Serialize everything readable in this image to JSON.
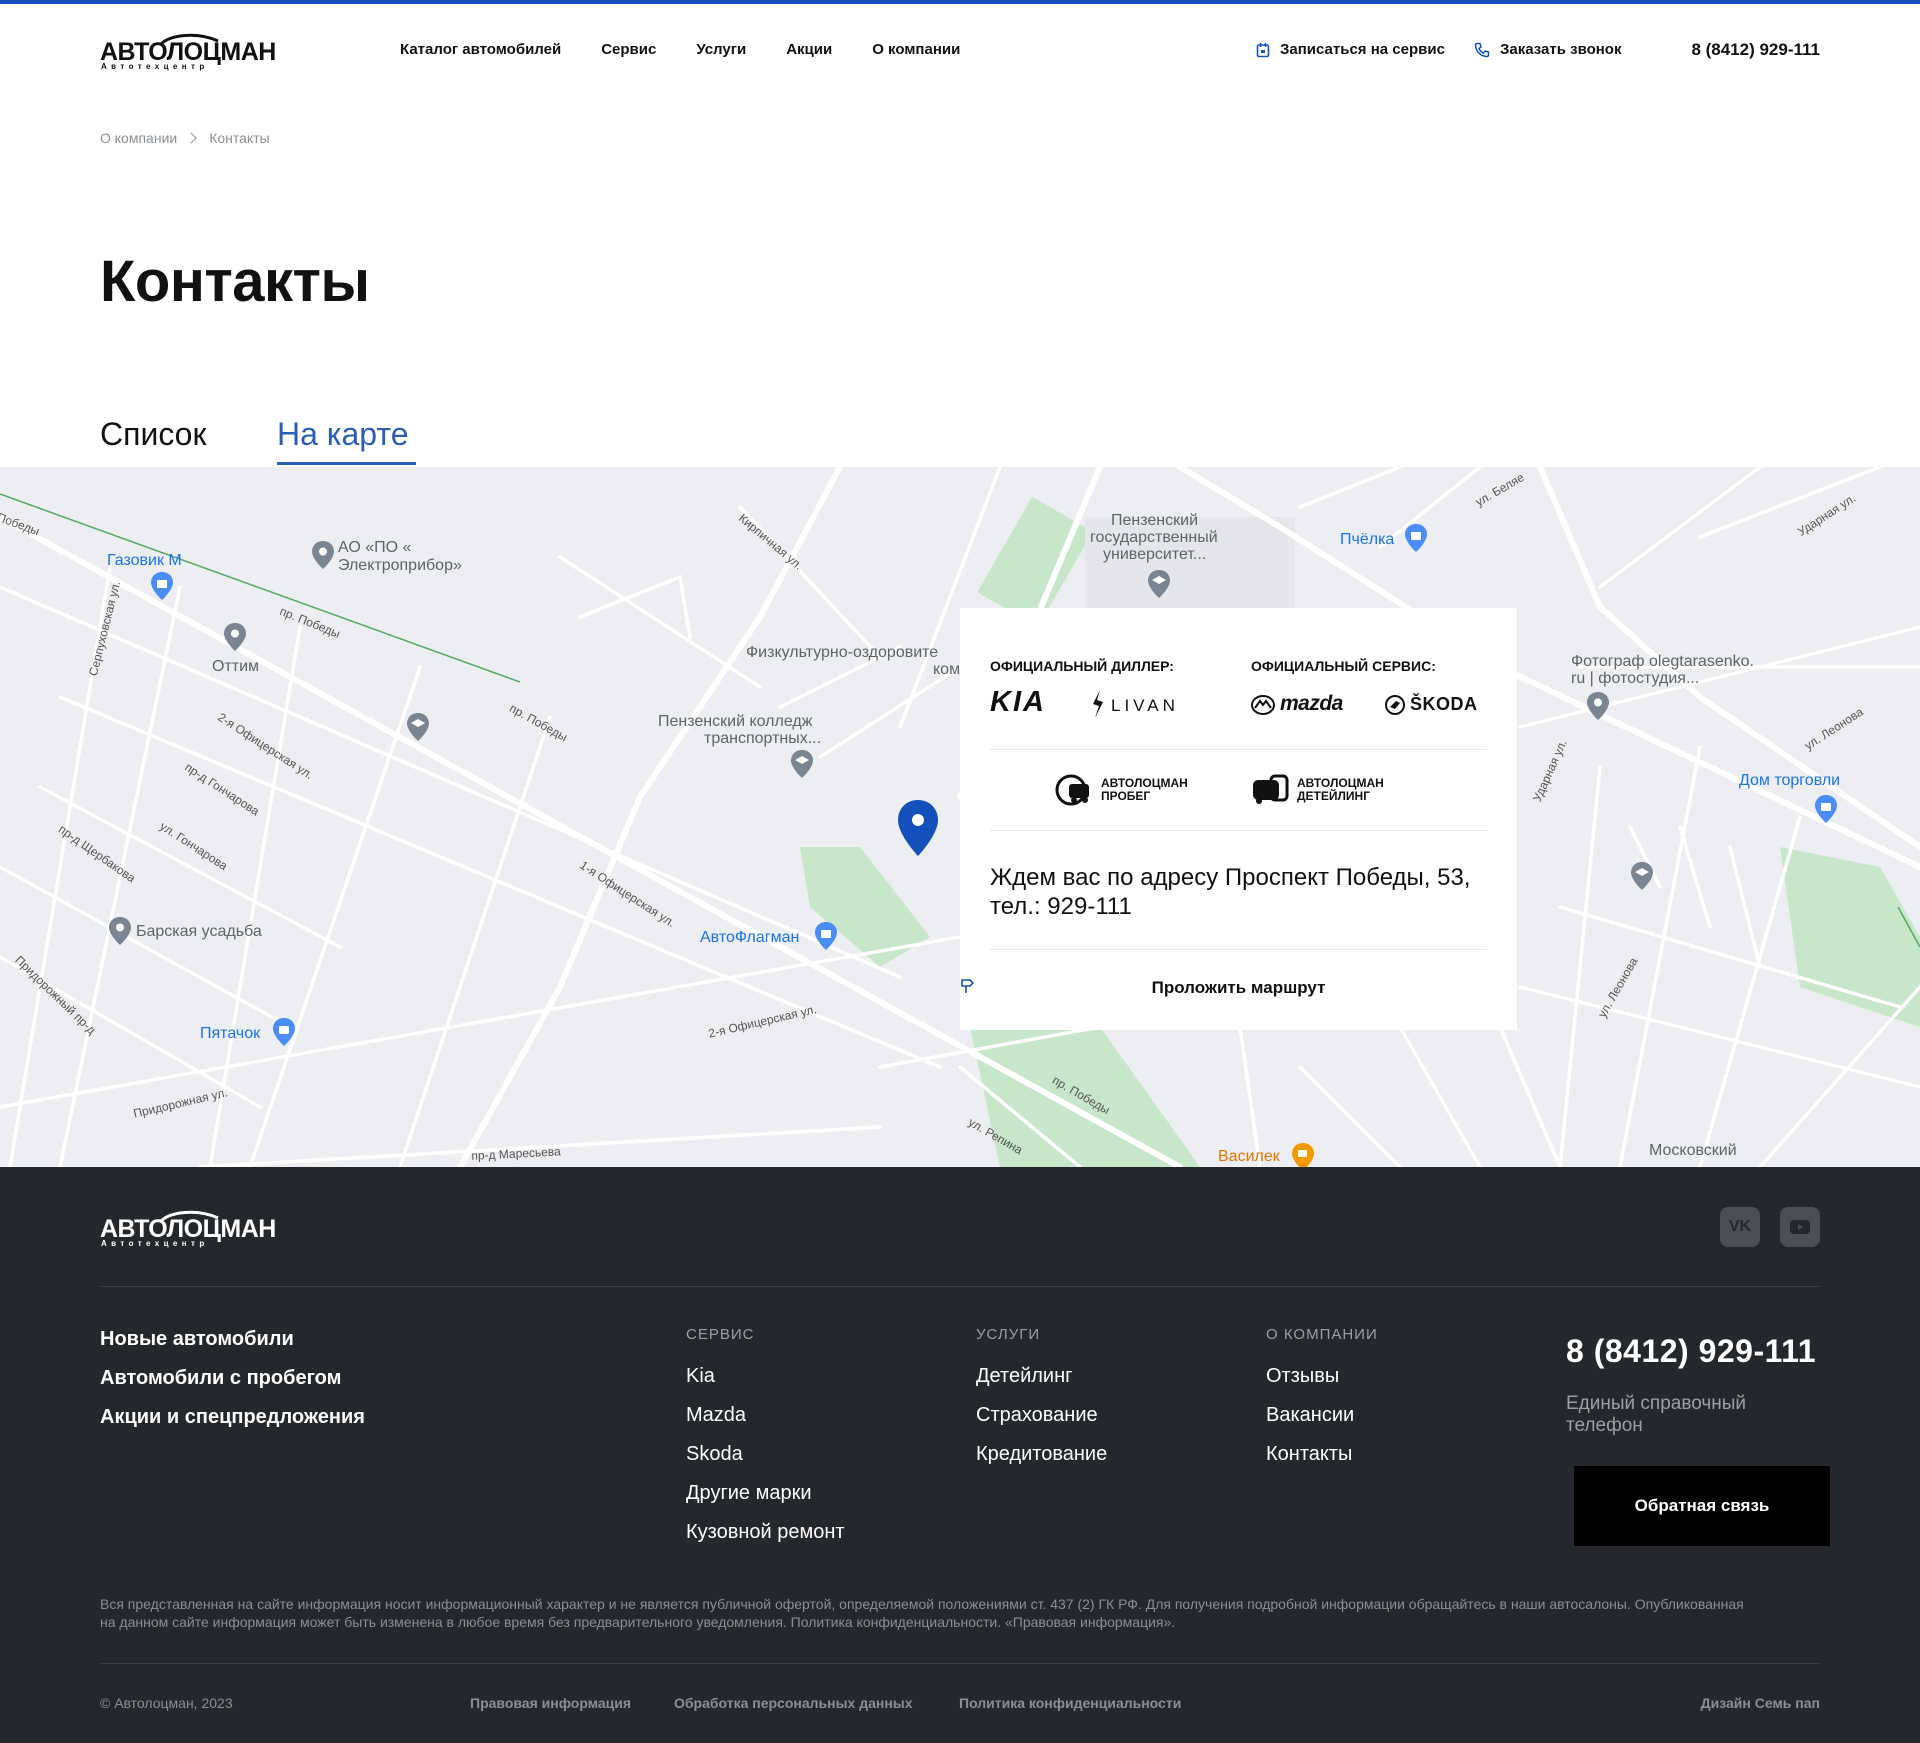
{
  "header": {
    "logo_text": "АВТОЛОЦМАН",
    "logo_sub": "Автотехцентр",
    "nav": [
      "Каталог автомобилей",
      "Сервис",
      "Услуги",
      "Акции",
      "О компании"
    ],
    "signup_service": "Записаться на сервис",
    "order_call": "Заказать звонок",
    "phone": "8 (8412) 929-111",
    "accent_color": "#1450b9"
  },
  "breadcrumbs": [
    "О компании",
    "Контакты"
  ],
  "page_title": "Контакты",
  "tabs": [
    {
      "label": "Список",
      "active": false
    },
    {
      "label": "На карте",
      "active": true
    }
  ],
  "map": {
    "places": {
      "gazovik": "Газовик М",
      "elektropribor_1": "АО «ПО «",
      "elektropribor_2": "Электроприбор»",
      "ottim": "Оттим",
      "university_1": "Пензенский",
      "university_2": "государственный",
      "university_3": "университет...",
      "pchelka": "Пчёлка",
      "fizkult": "Физкультурно-оздоровите",
      "fizkult_2": "ком",
      "college_1": "Пензенский колледж",
      "college_2": "транспортных...",
      "photographer_1": "Фотограф olegtarasenko.",
      "photographer_2": "ru | фотостудия...",
      "dom_torgovli": "Дом торговли",
      "barskaya": "Барская усадьба",
      "avtoflagman": "АвтоФлагман",
      "pyatachok": "Пятачок",
      "vasilek": "Василек",
      "moscow_uni": "Московский"
    },
    "streets": {
      "pobedy_1": "Победы",
      "pobedy_2": "пр. Победы",
      "pobedy_3": "пр. Победы",
      "pobedy_4": "пр. Победы",
      "serpukhovskaya": "Серпуховская ул.",
      "kirpichnaya": "Кирпичная ул.",
      "belyaeva": "ул. Беляе",
      "udarnaya_1": "Ударная ул.",
      "udarnaya_2": "Ударная ул.",
      "leonova_1": "ул. Леонова",
      "leonova_2": "ул. Леонова",
      "ofitserskaya_2": "2-я Офицерская ул.",
      "goncharova_pr": "пр-д Гончарова",
      "goncharova": "ул. Гончарова",
      "scherbakova": "пр-д Щербакова",
      "ofitserskaya_1": "1-я Офицерская ул.",
      "ofitserskaya_2b": "2-я Офицерская ул.",
      "pridorozhny_pr": "Придорожный пр-д",
      "pridorozhnaya": "Придорожная ул.",
      "maresyeva": "пр-д Маресьева",
      "repina": "ул. Репина"
    }
  },
  "card": {
    "dealer_caption": "ОФИЦИАЛЬНЫЙ ДИЛЛЕР:",
    "service_caption": "ОФИЦИАЛЬНЫЙ СЕРВИС:",
    "brand_kia": "KIA",
    "brand_livan": "LIVAN",
    "brand_mazda": "mazda",
    "brand_skoda": "ŠKODA",
    "sub_brand_1_line1": "АВТОЛОЦМАН",
    "sub_brand_1_line2": "ПРОБЕГ",
    "sub_brand_2_line1": "АВТОЛОЦМАН",
    "sub_brand_2_line2": "ДЕТЕЙЛИНГ",
    "address": "Ждем вас по адресу Проспект Победы, 53, тел.: 929-111",
    "route": "Проложить маршрут"
  },
  "footer": {
    "logo_text": "АВТОЛОЦМАН",
    "logo_sub": "Автотехцентр",
    "social": [
      "vk-icon",
      "youtube-icon"
    ],
    "main_links": [
      "Новые автомобили",
      "Автомобили с пробегом",
      "Акции и спецпредложения"
    ],
    "columns": [
      {
        "heading": "СЕРВИС",
        "items": [
          "Kia",
          "Mazda",
          "Skoda",
          "Другие марки",
          "Кузовной ремонт"
        ]
      },
      {
        "heading": "УСЛУГИ",
        "items": [
          "Детейлинг",
          "Страхование",
          "Кредитование"
        ]
      },
      {
        "heading": "О КОМПАНИИ",
        "items": [
          "Отзывы",
          "Вакансии",
          "Контакты"
        ]
      }
    ],
    "phone": "8 (8412) 929-111",
    "phone_label": "Единый справочный телефон",
    "feedback_button": "Обратная связь",
    "disclaimer": "Вся представленная на сайте информация носит информационный характер и не является публичной офертой, определяемой положениями ст. 437 (2) ГК РФ. Для получения подробной информации обращайтесь в наши автосалоны. Опубликованная на данном сайте информация может быть изменена в любое время без предварительного уведомления. Политика конфиденциальности. «Правовая информация».",
    "copyright": "© Автолоцман, 2023",
    "bottom_links": [
      "Правовая информация",
      "Обработка персональных данных",
      "Политика конфиденциальности"
    ],
    "design_credit": "Дизайн Семь пап"
  }
}
